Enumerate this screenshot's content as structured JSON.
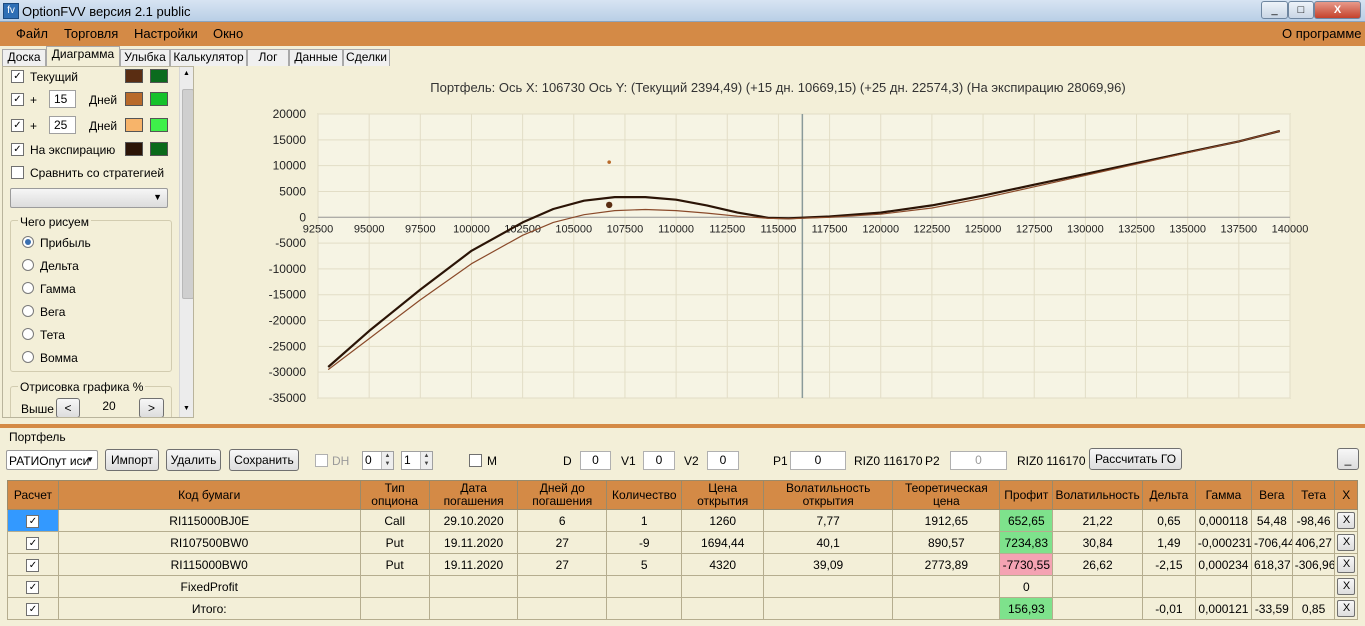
{
  "window": {
    "title": "OptionFVV версия 2.1 public",
    "icon_text": "fv",
    "min_label": "_",
    "max_label": "□",
    "close_label": "X"
  },
  "menu": {
    "items": [
      "Файл",
      "Торговля",
      "Настройки",
      "Окно"
    ],
    "about": "О программе"
  },
  "tabs": [
    "Доска",
    "Диаграмма",
    "Улыбка",
    "Калькулятор",
    "Лог",
    "Данные",
    "Сделки"
  ],
  "left_panel": {
    "current_label": "Текущий",
    "plus_sign": "+",
    "days1": "15",
    "days2": "25",
    "days_label": "Дней",
    "expiration_label": "На экспирацию",
    "compare_label": "Сравнить со стратегией",
    "draw_group_title": "Чего рисуем",
    "radios": [
      "Прибыль",
      "Дельта",
      "Гамма",
      "Вега",
      "Тета",
      "Вомма"
    ],
    "render_group_title": "Отрисовка графика %",
    "higher_label": "Выше",
    "higher_value": "20",
    "left_arrow": "<",
    "right_arrow": ">",
    "colors": {
      "current_a": "#5a2d12",
      "current_b": "#0b6b1e",
      "d15_a": "#b86a2a",
      "d15_b": "#16c22b",
      "d25_a": "#f7b46a",
      "d25_b": "#3ef04a",
      "exp_a": "#2b1406",
      "exp_b": "#0a6a1a"
    }
  },
  "chart_data": {
    "type": "line",
    "title": "Портфель: Ось X: 106730 Ось Y:  (Текущий 2394,49)  (+15 дн. 10669,15)  (+25 дн. 22574,3)  (На экспирацию 28069,96)",
    "xlim": [
      92500,
      140000
    ],
    "ylim": [
      -35000,
      20000
    ],
    "x_ticks": [
      "92500",
      "95000",
      "97500",
      "100000",
      "102500",
      "105000",
      "107500",
      "110000",
      "112500",
      "115000",
      "117500",
      "120000",
      "122500",
      "125000",
      "127500",
      "130000",
      "132500",
      "135000",
      "137500",
      "140000"
    ],
    "y_ticks": [
      "20000",
      "15000",
      "10000",
      "5000",
      "0",
      "-5000",
      "-10000",
      "-15000",
      "-20000",
      "-25000",
      "-30000",
      "-35000"
    ],
    "vertical_marker_x": 116170,
    "series": [
      {
        "color": "#2b1406",
        "x": [
          93000,
          95000,
          97500,
          100000,
          102500,
          104000,
          105500,
          107000,
          108500,
          110000,
          111500,
          113000,
          114500,
          115500,
          116500,
          117500,
          120000,
          122500,
          125000,
          127500,
          130000,
          132500,
          135000,
          137500,
          139500
        ],
        "y": [
          -29000,
          -22000,
          -14000,
          -6500,
          -1000,
          1600,
          3200,
          3900,
          3900,
          3400,
          2300,
          900,
          -100,
          -200,
          0,
          150,
          900,
          2300,
          4200,
          6300,
          8400,
          10500,
          12600,
          14700,
          16700
        ]
      },
      {
        "color": "#8a4a2a",
        "x": [
          93000,
          95000,
          97500,
          100000,
          102500,
          104000,
          105500,
          107000,
          108500,
          110000,
          111500,
          113000,
          114500,
          115500,
          116500,
          117500,
          120000,
          122500,
          125000,
          127500,
          130000,
          132500,
          135000,
          137500,
          139500
        ],
        "y": [
          -29500,
          -23500,
          -16000,
          -9000,
          -3500,
          -1000,
          500,
          1300,
          1500,
          1300,
          800,
          200,
          -200,
          -300,
          -150,
          0,
          600,
          1800,
          3700,
          5900,
          8100,
          10300,
          12500,
          14700,
          16700
        ]
      }
    ],
    "points": [
      {
        "x": 106730,
        "y": 2394,
        "color": "#5a2d12",
        "size": "large"
      },
      {
        "x": 106730,
        "y": 10669,
        "color": "#b86a2a",
        "size": "small"
      }
    ],
    "grid": true
  },
  "portfolio": {
    "title": "Портфель",
    "combo_value": "РАТИОпут иси",
    "import_label": "Импорт",
    "delete_label": "Удалить",
    "save_label": "Сохранить",
    "dh_label": "DH",
    "spin1": "0",
    "spin2": "1",
    "m_label": "M",
    "d_label": "D",
    "d_value": "0",
    "v1_label": "V1",
    "v1_value": "0",
    "v2_label": "V2",
    "v2_value": "0",
    "p1_label": "P1",
    "p1_value": "0",
    "riz1": "RIZ0 116170",
    "p2_label": "P2",
    "p2_value": "0",
    "riz2": "RIZ0 116170",
    "calc_go_label": "Рассчитать ГО",
    "minimize_label": "_"
  },
  "table": {
    "headers": [
      "Расчет",
      "Код бумаги",
      "Тип опциона",
      "Дата погашения",
      "Дней до погашения",
      "Количество",
      "Цена открытия",
      "Волатильность открытия",
      "Теоретическая цена",
      "Профит",
      "Волатильность",
      "Дельта",
      "Гамма",
      "Вега",
      "Тета",
      "X"
    ],
    "rows": [
      {
        "code": "RI115000BJ0E",
        "type": "Call",
        "date": "29.10.2020",
        "days": "6",
        "qty": "1",
        "price": "1260",
        "vol_open": "7,77",
        "theo": "1912,65",
        "profit": "652,65",
        "profit_state": "pos",
        "vol": "21,22",
        "delta": "0,65",
        "gamma": "0,000118",
        "vega": "54,48",
        "theta": "-98,46"
      },
      {
        "code": "RI107500BW0",
        "type": "Put",
        "date": "19.11.2020",
        "days": "27",
        "qty": "-9",
        "price": "1694,44",
        "vol_open": "40,1",
        "theo": "890,57",
        "profit": "7234,83",
        "profit_state": "pos",
        "vol": "30,84",
        "delta": "1,49",
        "gamma": "-0,000231",
        "vega": "-706,44",
        "theta": "406,27"
      },
      {
        "code": "RI115000BW0",
        "type": "Put",
        "date": "19.11.2020",
        "days": "27",
        "qty": "5",
        "price": "4320",
        "vol_open": "39,09",
        "theo": "2773,89",
        "profit": "-7730,55",
        "profit_state": "neg",
        "vol": "26,62",
        "delta": "-2,15",
        "gamma": "0,000234",
        "vega": "618,37",
        "theta": "-306,96"
      },
      {
        "code": "FixedProfit",
        "type": "",
        "date": "",
        "days": "",
        "qty": "",
        "price": "",
        "vol_open": "",
        "theo": "",
        "profit": "0",
        "profit_state": "none",
        "vol": "",
        "delta": "",
        "gamma": "",
        "vega": "",
        "theta": ""
      },
      {
        "code": "Итого:",
        "type": "",
        "date": "",
        "days": "",
        "qty": "",
        "price": "",
        "vol_open": "",
        "theo": "",
        "profit": "156,93",
        "profit_state": "pos",
        "vol": "",
        "delta": "-0,01",
        "gamma": "0,000121",
        "vega": "-33,59",
        "theta": "0,85"
      }
    ],
    "check_mark": "✓",
    "x_label": "X"
  }
}
